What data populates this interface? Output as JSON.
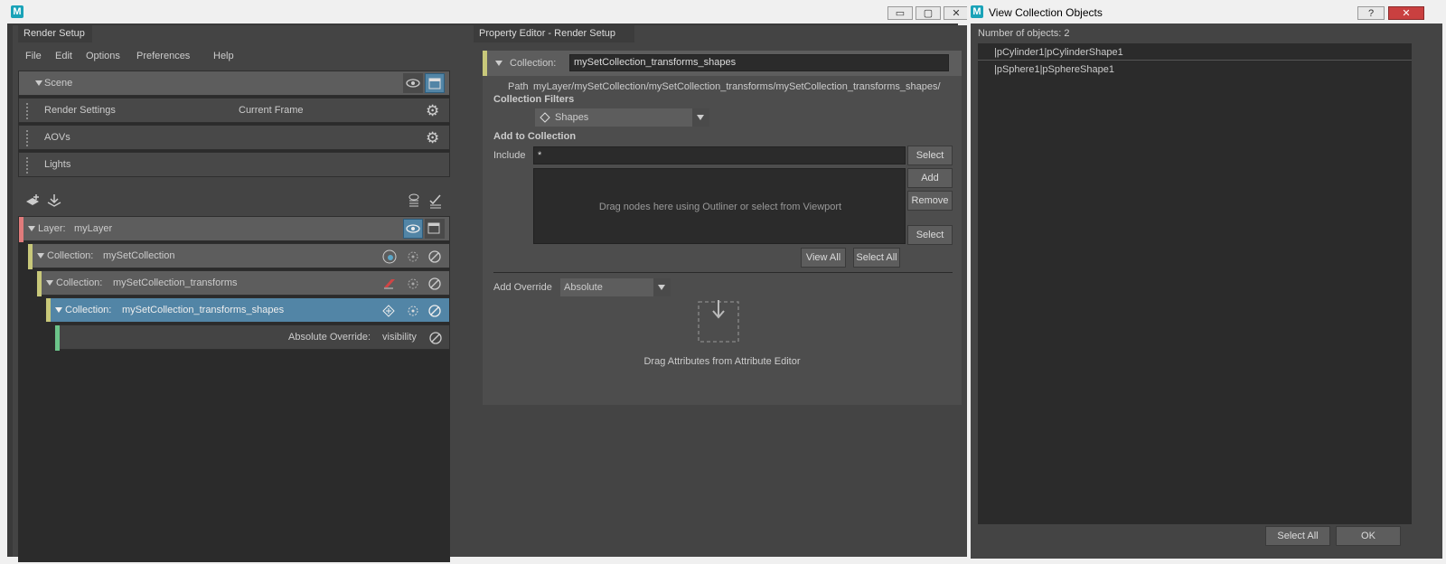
{
  "render_setup_window": {
    "tab_title": "Render Setup",
    "menu": [
      "File",
      "Edit",
      "Options",
      "Preferences",
      "Help"
    ],
    "scene_label": "Scene",
    "scene_rows": [
      {
        "label": "Render Settings",
        "extra": "Current Frame"
      },
      {
        "label": "AOVs",
        "extra": ""
      },
      {
        "label": "Lights",
        "extra": ""
      }
    ],
    "layer": {
      "label": "Layer:",
      "name": "myLayer"
    },
    "collections": [
      {
        "label": "Collection:",
        "name": "mySetCollection"
      },
      {
        "label": "Collection:",
        "name": "mySetCollection_transforms"
      },
      {
        "label": "Collection:",
        "name": "mySetCollection_transforms_shapes"
      }
    ],
    "override": {
      "label": "Absolute Override:",
      "attr": "visibility"
    }
  },
  "property_editor": {
    "tab_title": "Property Editor - Render Setup",
    "collection_label": "Collection:",
    "collection_value": "mySetCollection_transforms_shapes",
    "path_label": "Path",
    "path_value": "myLayer/mySetCollection/mySetCollection_transforms/mySetCollection_transforms_shapes/",
    "filters_heading": "Collection Filters",
    "filter_value": "Shapes",
    "add_heading": "Add to Collection",
    "include_label": "Include",
    "include_value": "*",
    "select_label": "Select",
    "add_label": "Add",
    "remove_label": "Remove",
    "select2_label": "Select",
    "drop_hint": "Drag nodes here using Outliner or select from Viewport",
    "view_all_label": "View All",
    "select_all_label": "Select All",
    "add_override_label": "Add Override",
    "override_type": "Absolute",
    "drag_attrs_hint": "Drag Attributes from Attribute Editor"
  },
  "view_objects_window": {
    "title": "View Collection Objects",
    "count_text": "Number of objects: 2",
    "objects": [
      "|pCylinder1|pCylinderShape1",
      "|pSphere1|pSphereShape1"
    ],
    "select_all_label": "Select All",
    "ok_label": "OK"
  },
  "colors": {
    "selected": "#5285a6",
    "layer": "#e07b7b",
    "collection": "#c8c87a",
    "override": "#6cc48a"
  }
}
